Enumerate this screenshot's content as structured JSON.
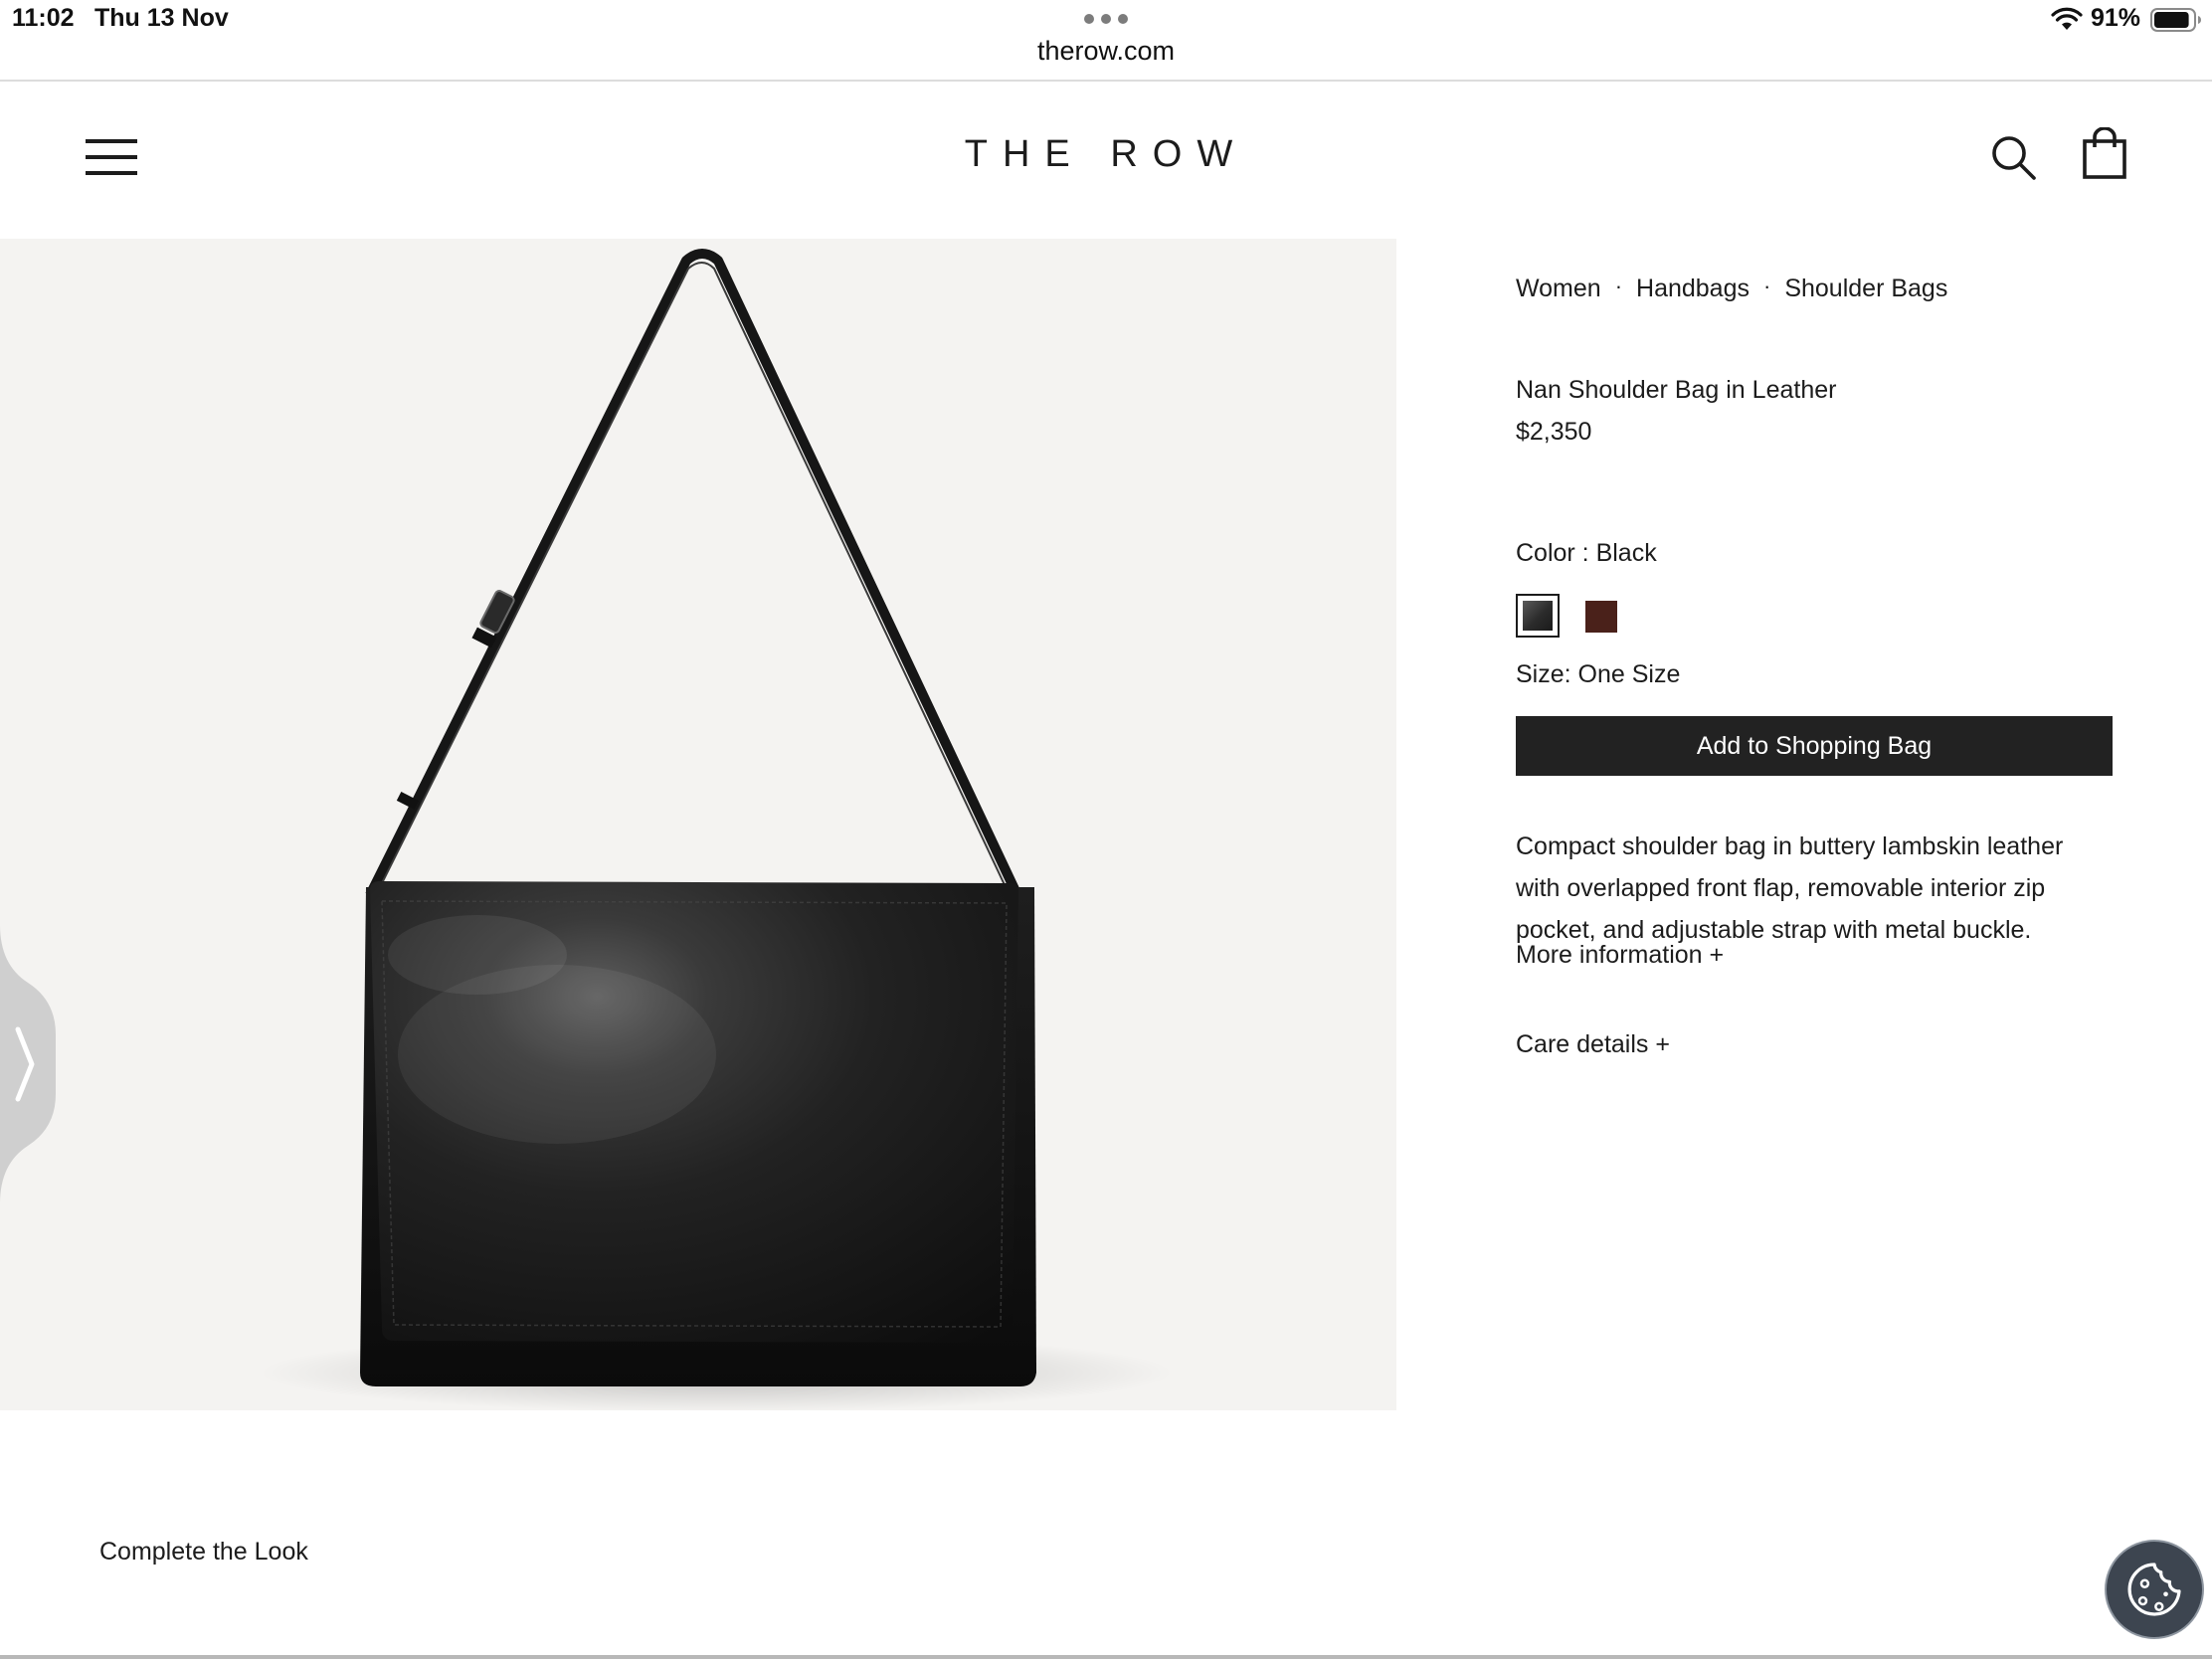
{
  "status_bar": {
    "time": "11:02",
    "date": "Thu 13 Nov",
    "url": "therow.com",
    "battery_percent": "91%",
    "battery_level": 0.91
  },
  "header": {
    "logo": "THE ROW",
    "icons": {
      "menu": "hamburger-menu-icon",
      "search": "search-icon",
      "bag": "shopping-bag-icon"
    }
  },
  "breadcrumb": {
    "items": [
      "Women",
      "Handbags",
      "Shoulder Bags"
    ],
    "separator": "·"
  },
  "product": {
    "name": "Nan Shoulder Bag in Leather",
    "price": "$2,350",
    "color_label": "Color : Black",
    "swatches": [
      {
        "name": "Black",
        "color": "#2b2b2b",
        "selected": true
      },
      {
        "name": "Brown",
        "color": "#4a211a",
        "selected": false
      }
    ],
    "size_label": "Size: One Size",
    "add_to_bag": "Add to Shopping Bag",
    "description": "Compact shoulder bag in buttery lambskin leather with overlapped front flap, removable interior zip pocket, and adjustable strap with metal buckle.",
    "more_information": "More information +",
    "care_details": "Care details +",
    "image_background": "#f4f3f1"
  },
  "complete_the_look": "Complete the Look",
  "colors": {
    "text": "#1c1c1c",
    "button_bg": "#222222",
    "button_text": "#ffffff",
    "cookie_bg": "#3d4550"
  }
}
